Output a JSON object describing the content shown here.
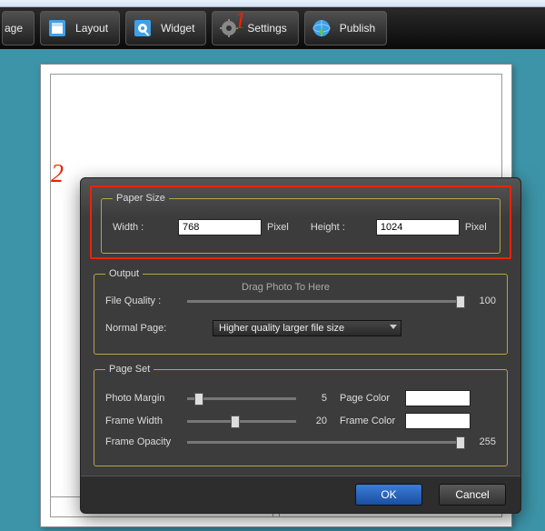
{
  "toolbar": {
    "page": "age",
    "layout": "Layout",
    "widget": "Widget",
    "settings": "Settings",
    "publish": "Publish"
  },
  "annotations": {
    "one": "1",
    "two": "2"
  },
  "dialog": {
    "paper_size": {
      "legend": "Paper Size",
      "width_label": "Width :",
      "width_value": "768",
      "width_unit": "Pixel",
      "height_label": "Height :",
      "height_value": "1024",
      "height_unit": "Pixel"
    },
    "output": {
      "legend": "Output",
      "quality_label": "File Quality :",
      "quality_value": "100",
      "page_label": "Normal Page:",
      "page_option": "Higher quality larger file size",
      "ghost": "Drag Photo To Here"
    },
    "page_set": {
      "legend": "Page Set",
      "margin_label": "Photo Margin",
      "margin_value": "5",
      "page_color_label": "Page Color",
      "frame_width_label": "Frame Width",
      "frame_width_value": "20",
      "frame_color_label": "Frame Color",
      "opacity_label": "Frame Opacity",
      "opacity_value": "255"
    },
    "buttons": {
      "ok": "OK",
      "cancel": "Cancel"
    }
  },
  "colors": {
    "page_color": "#ffffff",
    "frame_color": "#ffffff"
  }
}
